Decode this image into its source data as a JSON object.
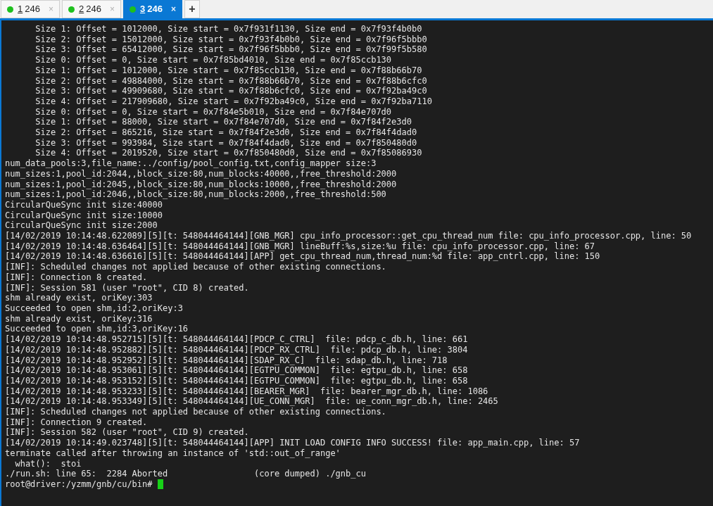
{
  "tabs": [
    {
      "number": "1",
      "name": "246",
      "close": "×",
      "selected": false
    },
    {
      "number": "2",
      "name": "246",
      "close": "×",
      "selected": false
    },
    {
      "number": "3",
      "name": "246",
      "close": "×",
      "selected": true
    }
  ],
  "new_tab": "+",
  "terminal": {
    "lines": [
      "      Size 1: Offset = 1012000, Size start = 0x7f931f1130, Size end = 0x7f93f4b0b0",
      "      Size 2: Offset = 15012000, Size start = 0x7f93f4b0b0, Size end = 0x7f96f5bbb0",
      "      Size 3: Offset = 65412000, Size start = 0x7f96f5bbb0, Size end = 0x7f99f5b580",
      "      Size 0: Offset = 0, Size start = 0x7f85bd4010, Size end = 0x7f85ccb130",
      "      Size 1: Offset = 1012000, Size start = 0x7f85ccb130, Size end = 0x7f88b66b70",
      "      Size 2: Offset = 49884000, Size start = 0x7f88b66b70, Size end = 0x7f88b6cfc0",
      "      Size 3: Offset = 49909680, Size start = 0x7f88b6cfc0, Size end = 0x7f92ba49c0",
      "      Size 4: Offset = 217909680, Size start = 0x7f92ba49c0, Size end = 0x7f92ba7110",
      "      Size 0: Offset = 0, Size start = 0x7f84e5b010, Size end = 0x7f84e707d0",
      "      Size 1: Offset = 88000, Size start = 0x7f84e707d0, Size end = 0x7f84f2e3d0",
      "      Size 2: Offset = 865216, Size start = 0x7f84f2e3d0, Size end = 0x7f84f4dad0",
      "      Size 3: Offset = 993984, Size start = 0x7f84f4dad0, Size end = 0x7f850480d0",
      "      Size 4: Offset = 2019520, Size start = 0x7f850480d0, Size end = 0x7f85086930",
      "num_data_pools:3,file_name:../config/pool_config.txt,config_mapper size:3",
      "num_sizes:1,pool_id:2044,,block_size:80,num_blocks:40000,,free_threshold:2000",
      "num_sizes:1,pool_id:2045,,block_size:80,num_blocks:10000,,free_threshold:2000",
      "num_sizes:1,pool_id:2046,,block_size:80,num_blocks:2000,,free_threshold:500",
      "CircularQueSync init size:40000",
      "CircularQueSync init size:10000",
      "CircularQueSync init size:2000",
      "[14/02/2019 10:14:48.622089][5][t: 548044464144][GNB_MGR] cpu_info_processor::get_cpu_thread_num file: cpu_info_processor.cpp, line: 50",
      "[14/02/2019 10:14:48.636464][5][t: 548044464144][GNB_MGR] lineBuff:%s,size:%u file: cpu_info_processor.cpp, line: 67",
      "[14/02/2019 10:14:48.636616][5][t: 548044464144][APP] get_cpu_thread_num,thread_num:%d file: app_cntrl.cpp, line: 150",
      "[INF]: Scheduled changes not applied because of other existing connections.",
      "[INF]: Connection 8 created.",
      "[INF]: Session 581 (user \"root\", CID 8) created.",
      "shm already exist, oriKey:303",
      "Succeeded to open shm,id:2,oriKey:3",
      "shm already exist, oriKey:316",
      "Succeeded to open shm,id:3,oriKey:16",
      "[14/02/2019 10:14:48.952715][5][t: 548044464144][PDCP_C_CTRL]  file: pdcp_c_db.h, line: 661",
      "[14/02/2019 10:14:48.952882][5][t: 548044464144][PDCP_RX_CTRL]  file: pdcp_db.h, line: 3804",
      "[14/02/2019 10:14:48.952952][5][t: 548044464144][SDAP_RX_C]  file: sdap_db.h, line: 718",
      "[14/02/2019 10:14:48.953061][5][t: 548044464144][EGTPU_COMMON]  file: egtpu_db.h, line: 658",
      "[14/02/2019 10:14:48.953152][5][t: 548044464144][EGTPU_COMMON]  file: egtpu_db.h, line: 658",
      "[14/02/2019 10:14:48.953233][5][t: 548044464144][BEARER_MGR]  file: bearer_mgr_db.h, line: 1086",
      "[14/02/2019 10:14:48.953349][5][t: 548044464144][UE_CONN_MGR]  file: ue_conn_mgr_db.h, line: 2465",
      "[INF]: Scheduled changes not applied because of other existing connections.",
      "[INF]: Connection 9 created.",
      "[INF]: Session 582 (user \"root\", CID 9) created.",
      "[14/02/2019 10:14:49.023748][5][t: 548044464144][APP] INIT LOAD CONFIG INFO SUCCESS! file: app_main.cpp, line: 57",
      "terminate called after throwing an instance of 'std::out_of_range'",
      "  what():  stoi",
      "./run.sh: line 65:  2284 Aborted                 (core dumped) ./gnb_cu"
    ],
    "prompt": "root@driver:/yzmm/gnb/cu/bin# "
  }
}
